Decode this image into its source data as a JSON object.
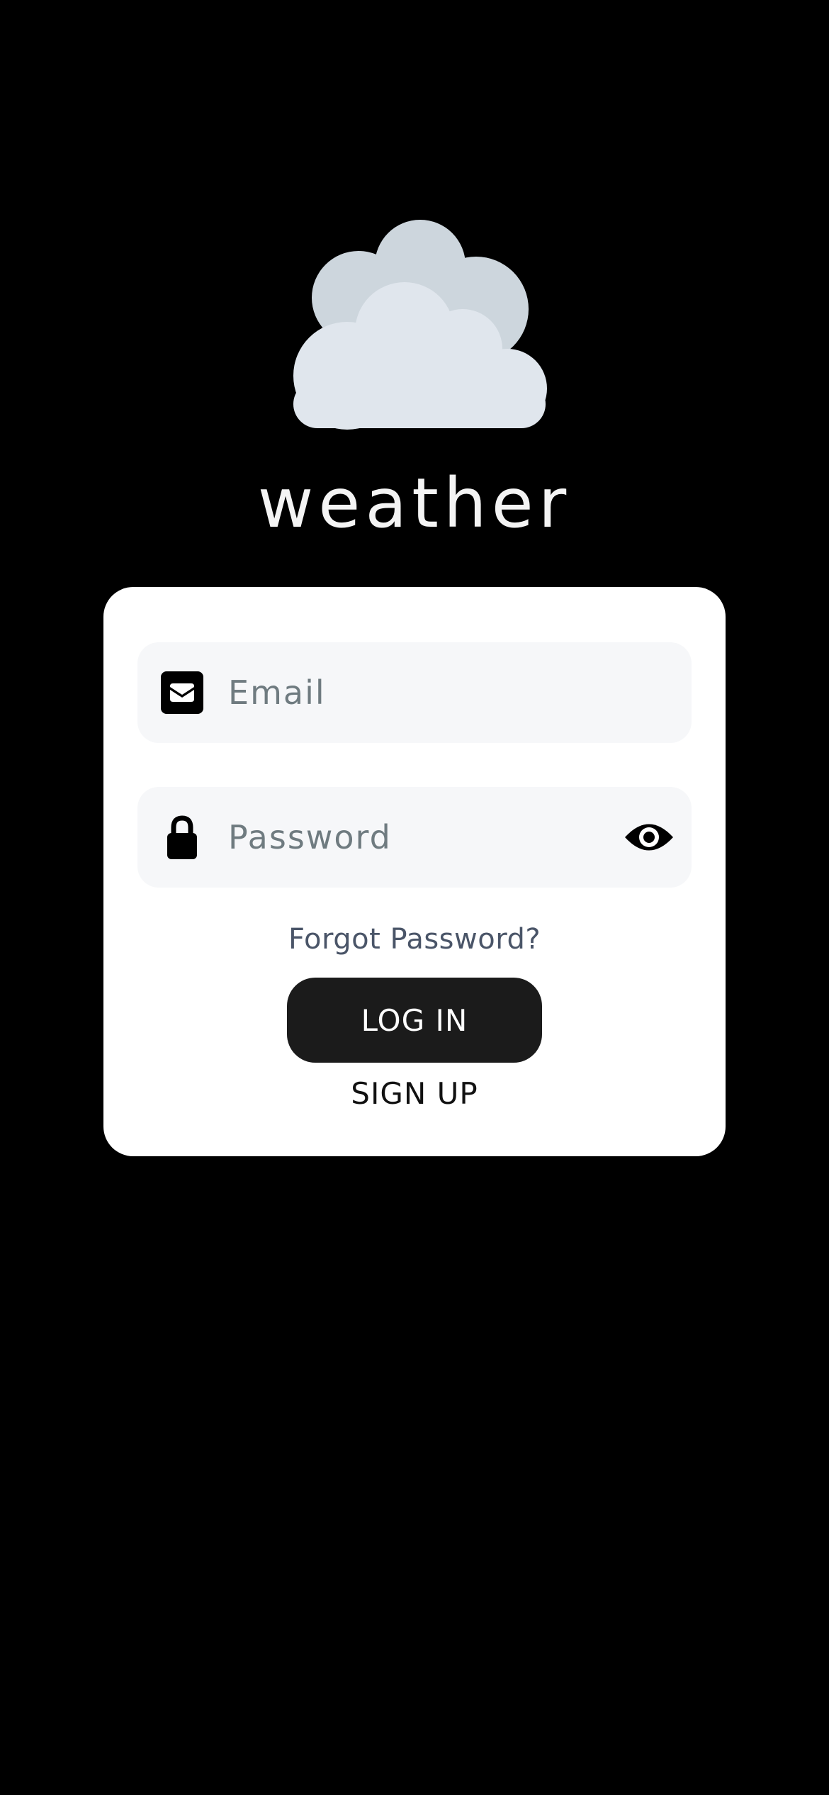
{
  "app": {
    "title": "weather",
    "logo_icon": "cloud-icon",
    "logo_colors": {
      "back_cloud": "#cdd6dd",
      "front_cloud": "#e0e6ed"
    }
  },
  "form": {
    "email": {
      "placeholder": "Email",
      "value": "",
      "icon": "envelope-icon"
    },
    "password": {
      "placeholder": "Password",
      "value": "",
      "icon": "lock-icon",
      "toggle_icon": "eye-icon"
    },
    "forgot_label": "Forgot Password?",
    "login_label": "LOG IN",
    "signup_label": "SIGN UP"
  },
  "colors": {
    "background": "#000000",
    "card": "#ffffff",
    "field_bg": "#f6f7f9",
    "button_bg": "#1b1b1b",
    "button_text": "#ffffff",
    "link_muted": "#4a5568"
  }
}
